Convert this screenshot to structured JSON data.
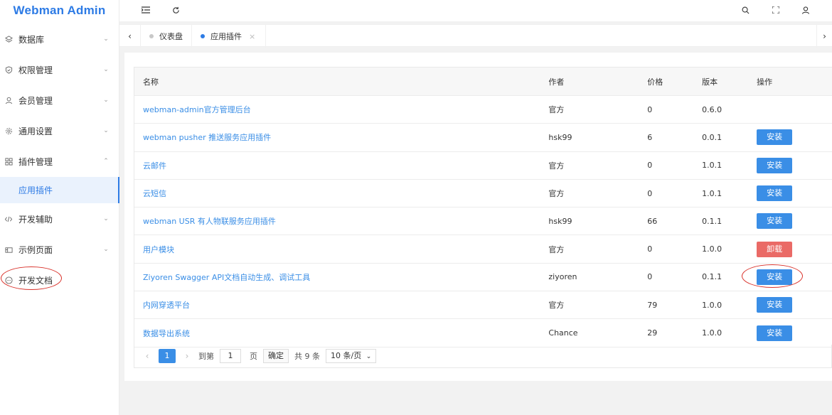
{
  "app": {
    "title": "Webman Admin"
  },
  "sidebar": {
    "items": [
      {
        "label": "数据库",
        "icon": "layers-icon",
        "chevron": "⌄"
      },
      {
        "label": "权限管理",
        "icon": "shield-icon",
        "chevron": "⌄"
      },
      {
        "label": "会员管理",
        "icon": "user-icon",
        "chevron": "⌄"
      },
      {
        "label": "通用设置",
        "icon": "gear-icon",
        "chevron": "⌄"
      },
      {
        "label": "插件管理",
        "icon": "apps-icon",
        "chevron": "⌃"
      },
      {
        "label": "开发辅助",
        "icon": "code-icon",
        "chevron": "⌄"
      },
      {
        "label": "示例页面",
        "icon": "template-icon",
        "chevron": "⌄"
      },
      {
        "label": "开发文档",
        "icon": "doc-icon",
        "chevron": ""
      }
    ],
    "sub_active": "应用插件"
  },
  "tabs": [
    {
      "label": "仪表盘",
      "dot_color": "#c8c8c8",
      "closable": false
    },
    {
      "label": "应用插件",
      "dot_color": "#2d7be5",
      "closable": true
    }
  ],
  "table": {
    "headers": [
      "名称",
      "作者",
      "价格",
      "版本",
      "操作"
    ],
    "rows": [
      {
        "name": "webman-admin官方管理后台",
        "author": "官方",
        "price": "0",
        "version": "0.6.0",
        "action": ""
      },
      {
        "name": "webman pusher 推送服务应用插件",
        "author": "hsk99",
        "price": "6",
        "version": "0.0.1",
        "action": "安装"
      },
      {
        "name": "云邮件",
        "author": "官方",
        "price": "0",
        "version": "1.0.1",
        "action": "安装"
      },
      {
        "name": "云短信",
        "author": "官方",
        "price": "0",
        "version": "1.0.1",
        "action": "安装"
      },
      {
        "name": "webman USR 有人物联服务应用插件",
        "author": "hsk99",
        "price": "66",
        "version": "0.1.1",
        "action": "安装"
      },
      {
        "name": "用户模块",
        "author": "官方",
        "price": "0",
        "version": "1.0.0",
        "action": "卸载"
      },
      {
        "name": "Ziyoren Swagger API文档自动生成、调试工具",
        "author": "ziyoren",
        "price": "0",
        "version": "0.1.1",
        "action": "安装"
      },
      {
        "name": "内网穿透平台",
        "author": "官方",
        "price": "79",
        "version": "1.0.0",
        "action": "安装"
      },
      {
        "name": "数据导出系统",
        "author": "Chance",
        "price": "29",
        "version": "1.0.0",
        "action": "安装"
      }
    ]
  },
  "pagination": {
    "current": "1",
    "goto_label": "到第",
    "goto_value": "1",
    "page_label": "页",
    "confirm_label": "确定",
    "total_label": "共 9 条",
    "page_size_label": "10 条/页"
  },
  "colors": {
    "accent": "#2d7be5",
    "install": "#3a8ee6",
    "uninstall": "#ea6a66",
    "highlight": "#d9322b"
  }
}
